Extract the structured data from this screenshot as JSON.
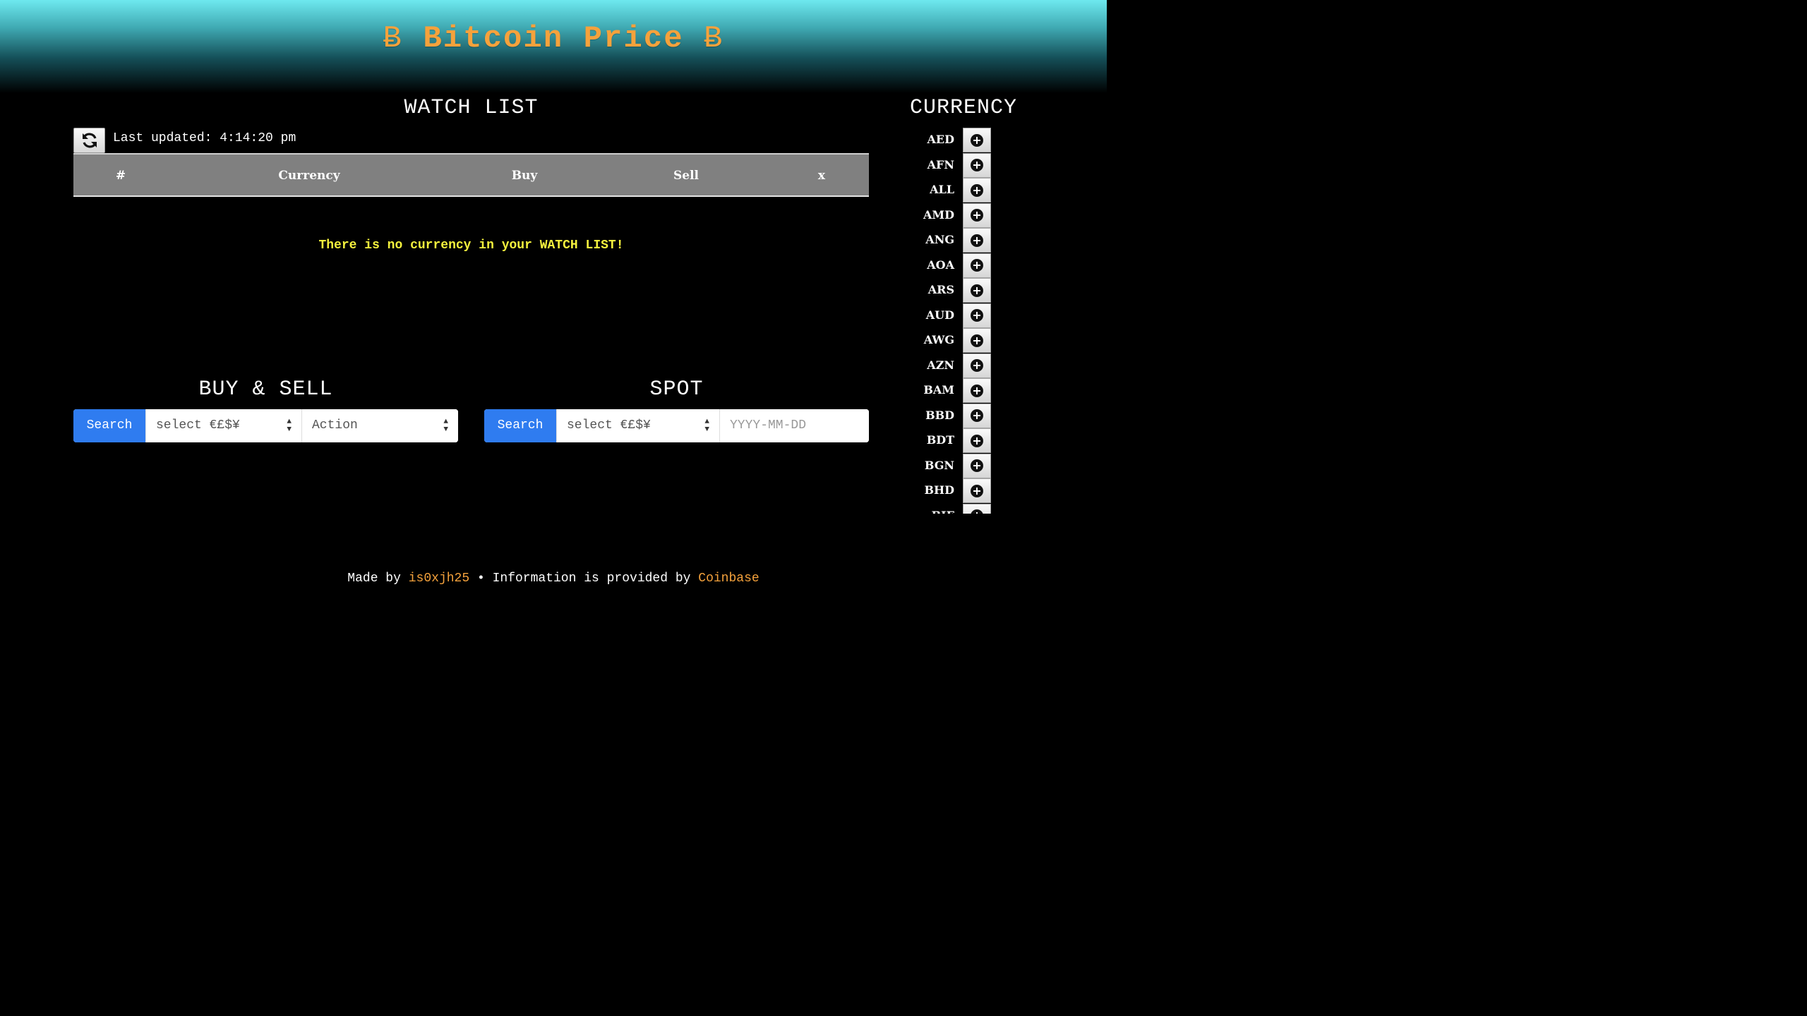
{
  "header": {
    "coin_symbol": "Ƀ",
    "title": "Bitcoin Price"
  },
  "watchlist": {
    "title": "WATCH LIST",
    "last_updated": "Last updated: 4:14:20 pm",
    "columns": [
      "#",
      "Currency",
      "Buy",
      "Sell",
      "x"
    ],
    "empty_message": "There is no currency in your WATCH LIST!"
  },
  "buy_sell": {
    "title": "BUY & SELL",
    "search_label": "Search",
    "currency_select": "select €£$¥",
    "action_select": "Action"
  },
  "spot": {
    "title": "SPOT",
    "search_label": "Search",
    "currency_select": "select €£$¥",
    "date_placeholder": "YYYY-MM-DD"
  },
  "currency": {
    "title": "CURRENCY",
    "items": [
      "AED",
      "AFN",
      "ALL",
      "AMD",
      "ANG",
      "AOA",
      "ARS",
      "AUD",
      "AWG",
      "AZN",
      "BAM",
      "BBD",
      "BDT",
      "BGN",
      "BHD",
      "BIF"
    ]
  },
  "footer": {
    "made_by": "Made by",
    "author": "is0xjh25",
    "separator": "•",
    "info": "Information is provided by",
    "provider": "Coinbase"
  },
  "colors": {
    "accent": "#f5a23c",
    "search_button": "#2f7cf0",
    "empty_message": "#f5f23d",
    "table_header": "#808080"
  }
}
